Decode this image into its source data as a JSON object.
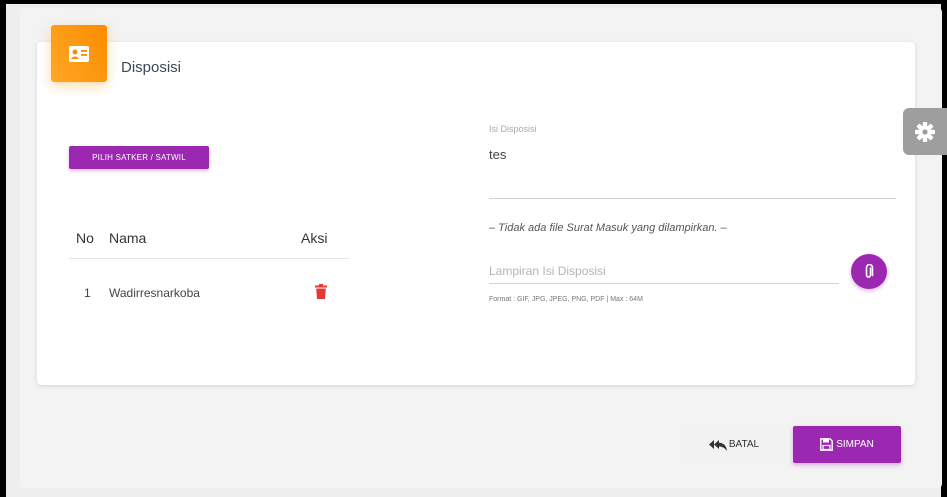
{
  "card": {
    "title": "Disposisi",
    "icon": "contact-card-icon",
    "accent_color": "#ff9800"
  },
  "pilih_button": {
    "label": "PILIH SATKER / SATWIL"
  },
  "table": {
    "headers": {
      "no": "No",
      "nama": "Nama",
      "aksi": "Aksi"
    },
    "rows": [
      {
        "no": "1",
        "nama": "Wadirresnarkoba",
        "action_icon": "trash-icon"
      }
    ]
  },
  "isi": {
    "label": "Isi Disposisi",
    "value": "tes"
  },
  "no_file_text": "– Tidak ada file Surat Masuk yang dilampirkan. –",
  "lampiran": {
    "placeholder": "Lampiran Isi Disposisi",
    "icon": "paperclip-icon",
    "format_note": "Format : GIF, JPG, JPEG, PNG, PDF | Max : 64M"
  },
  "settings": {
    "icon": "gear-icon"
  },
  "actions": {
    "batal_label": "BATAL",
    "simpan_label": "SIMPAN"
  },
  "colors": {
    "primary": "#9c27b0",
    "danger": "#e53935",
    "neutral_tab": "#9e9e9e"
  }
}
